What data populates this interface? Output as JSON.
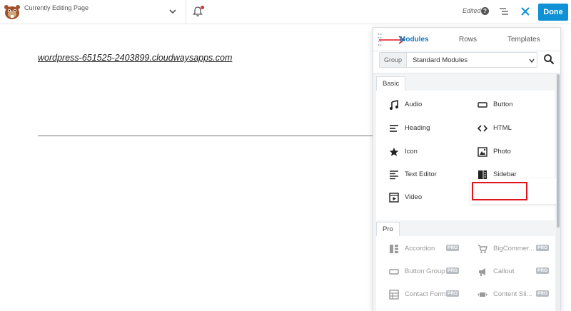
{
  "topbar": {
    "page_label": "Currently Editing Page",
    "edited_label": "Edited",
    "help_symbol": "?",
    "done_label": "Done",
    "accent_color": "#0e91d5"
  },
  "content": {
    "site_link": "wordpress-651525-2403899.cloudwaysapps.com"
  },
  "panel": {
    "tabs": [
      {
        "label": "Modules",
        "active": true
      },
      {
        "label": "Rows",
        "active": false
      },
      {
        "label": "Templates",
        "active": false
      }
    ],
    "group": {
      "tag": "Group",
      "value": "Standard Modules"
    },
    "sections": [
      {
        "label": "Basic",
        "modules": [
          {
            "label": "Audio",
            "icon": "music-note-icon"
          },
          {
            "label": "Button",
            "icon": "button-icon"
          },
          {
            "label": "Heading",
            "icon": "heading-icon"
          },
          {
            "label": "HTML",
            "icon": "code-icon"
          },
          {
            "label": "Icon",
            "icon": "star-icon"
          },
          {
            "label": "Photo",
            "icon": "photo-icon"
          },
          {
            "label": "Text Editor",
            "icon": "text-editor-icon"
          },
          {
            "label": "Sidebar",
            "icon": "sidebar-icon"
          },
          {
            "label": "Video",
            "icon": "video-icon"
          }
        ]
      },
      {
        "label": "Pro",
        "badge": "PRO",
        "modules": [
          {
            "label": "Accordion",
            "icon": "accordion-icon"
          },
          {
            "label": "BigCommer...",
            "icon": "cart-icon"
          },
          {
            "label": "Button Group",
            "icon": "button-group-icon"
          },
          {
            "label": "Callout",
            "icon": "megaphone-icon"
          },
          {
            "label": "Contact Form",
            "icon": "form-icon"
          },
          {
            "label": "Content Sli...",
            "icon": "slider-icon"
          }
        ]
      }
    ]
  }
}
